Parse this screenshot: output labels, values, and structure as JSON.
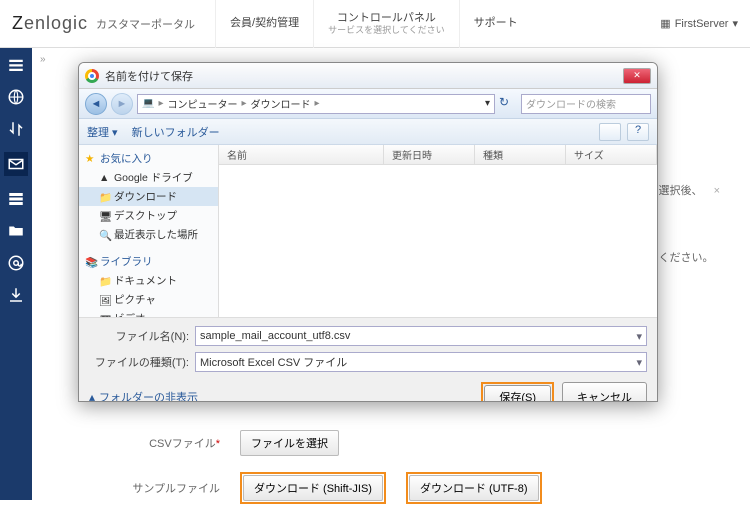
{
  "header": {
    "logo": "Zenlogic",
    "portal": "カスタマーポータル",
    "nav": [
      {
        "label": "会員/契約管理"
      },
      {
        "label": "コントロールパネル",
        "sub": "サービスを選択してください"
      },
      {
        "label": "サポート"
      }
    ],
    "user": "FirstServer"
  },
  "breadcrumb": "»",
  "background": {
    "line1_tail": "ァイル選択後、",
    "line2_tail": "ご用意ください。",
    "csv_label": "CSVファイル",
    "csv_button": "ファイルを選択",
    "sample_label": "サンプルファイル",
    "sample_btn1": "ダウンロード (Shift-JIS)",
    "sample_btn2": "ダウンロード (UTF-8)"
  },
  "dialog": {
    "title": "名前を付けて保存",
    "path": {
      "root": "コンピューター",
      "folder": "ダウンロード"
    },
    "search_placeholder": "ダウンロードの検索",
    "toolbar": {
      "organize": "整理 ▾",
      "newfolder": "新しいフォルダー"
    },
    "tree": {
      "favorites": "お気に入り",
      "items_fav": [
        "Google ドライブ",
        "ダウンロード",
        "デスクトップ",
        "最近表示した場所"
      ],
      "library": "ライブラリ",
      "items_lib": [
        "ドキュメント",
        "ピクチャ",
        "ビデオ"
      ]
    },
    "columns": [
      "名前",
      "更新日時",
      "種類",
      "サイズ"
    ],
    "filename_label": "ファイル名(N):",
    "filename_value": "sample_mail_account_utf8.csv",
    "filetype_label": "ファイルの種類(T):",
    "filetype_value": "Microsoft Excel CSV ファイル",
    "hide_folders": "フォルダーの非表示",
    "save": "保存(S)",
    "cancel": "キャンセル"
  }
}
